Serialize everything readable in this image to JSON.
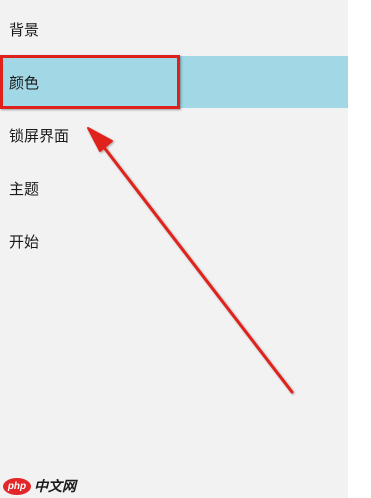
{
  "sidebar": {
    "items": [
      {
        "label": "背景",
        "selected": false
      },
      {
        "label": "颜色",
        "selected": true
      },
      {
        "label": "锁屏界面",
        "selected": false
      },
      {
        "label": "主题",
        "selected": false
      },
      {
        "label": "开始",
        "selected": false
      }
    ]
  },
  "colors": {
    "selected_background": "#a2d7e6",
    "annotation_red": "#e0201a",
    "sidebar_background": "#f2f2f2"
  },
  "watermark": {
    "logo_text": "php",
    "text": "中文网"
  }
}
